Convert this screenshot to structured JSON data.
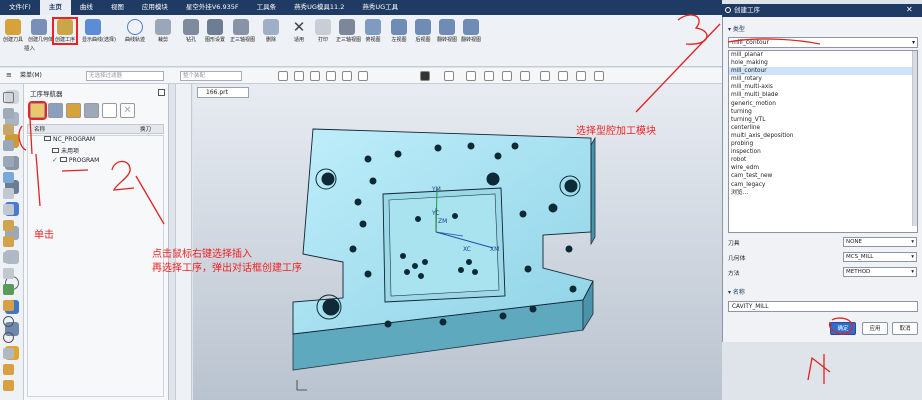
{
  "menubar": {
    "items": [
      "文件(F)",
      "主页",
      "曲线",
      "视图",
      "应用模块",
      "星空外挂V6.935F",
      "工具条",
      "燕秀UG模具11.2",
      "燕秀UG工具"
    ],
    "active_index": 1
  },
  "ribbon": {
    "buttons": [
      "创建刀具",
      "创建几何体",
      "创建工序",
      "显示曲线(选择)",
      "曲线轨迹",
      "裁剪",
      "钻孔",
      "图形设置",
      "正三轴视图",
      "删除",
      "适用",
      "打印",
      "正三轴视图",
      "俯视图",
      "左视图",
      "后视图",
      "翻转视图"
    ],
    "group_label": "插入"
  },
  "toolbar2": {
    "menu_label": "菜单(M)",
    "filter_placeholder": "无选择过滤器",
    "assembly_placeholder": "整个装配"
  },
  "navigator": {
    "title": "工序导航器",
    "col_name": "名称",
    "col_tool": "换刀",
    "tree": [
      "NC_PROGRAM",
      "未用项",
      "PROGRAM"
    ]
  },
  "file_tab": "166.prt",
  "axis_labels": {
    "ym": "YM",
    "yc": "YC",
    "zm": "ZM",
    "xc": "XC",
    "xm": "XM"
  },
  "dialog": {
    "title": "创建工序",
    "type_section": "类型",
    "type_value": "mill_contour",
    "type_options": [
      "mill_planar",
      "hole_making",
      "mill_contour",
      "mill_rotary",
      "mill_multi-axis",
      "mill_multi_blade",
      "generic_motion",
      "turning",
      "turning_VTL",
      "centerline",
      "multi_axis_deposition",
      "probing",
      "inspection",
      "robot",
      "wire_edm",
      "cam_test_new",
      "cam_legacy",
      "浏览..."
    ],
    "selected_index": 2,
    "fields": [
      {
        "label": "刀具",
        "value": "NONE"
      },
      {
        "label": "几何体",
        "value": "MCS_MILL"
      },
      {
        "label": "方法",
        "value": "METHOD"
      }
    ],
    "name_section": "名称",
    "name_value": "CAVITY_MILL",
    "ok_label": "确定",
    "apply_label": "应用",
    "cancel_label": "取消"
  },
  "annotations": {
    "step1_label": "单击",
    "step2_line1": "点击鼠标右键选择插入",
    "step2_line2": "再选择工序，弹出对话框创建工序",
    "step3_label": "选择型腔加工模块",
    "color": "#e22222"
  }
}
